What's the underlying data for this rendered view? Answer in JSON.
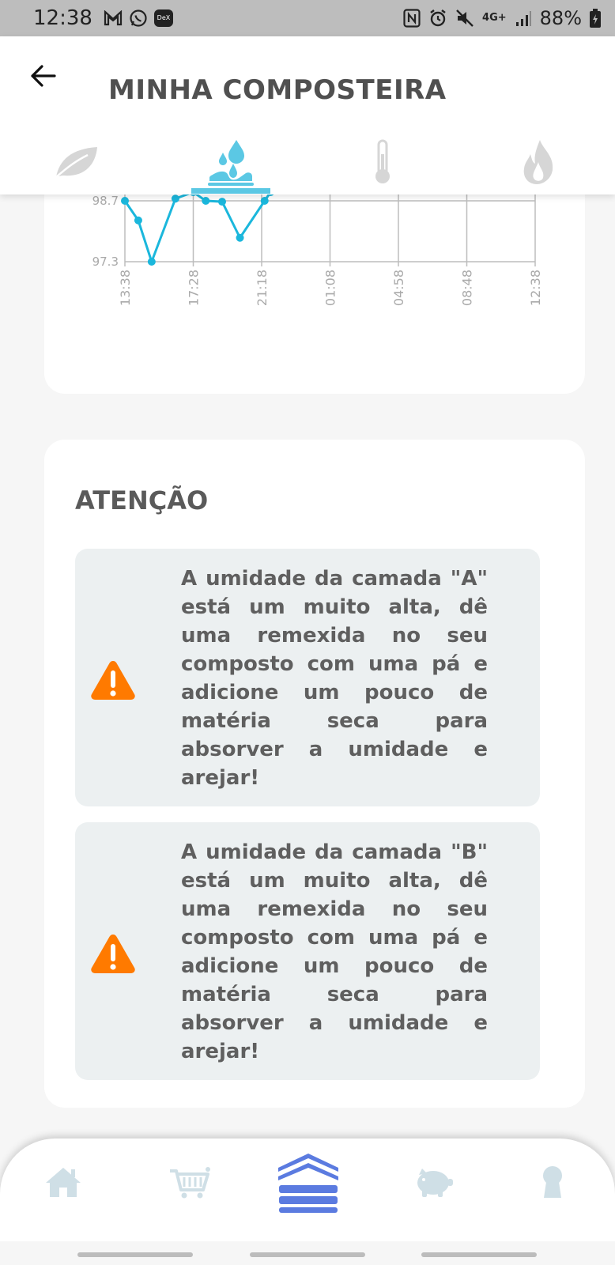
{
  "status_bar": {
    "time": "12:38",
    "left_icons": [
      "gmail-icon",
      "whatsapp-icon",
      "dex-icon"
    ],
    "dex_label": "DeX",
    "network": "4G+",
    "battery": "88%",
    "right_icons": [
      "nfc-icon",
      "alarm-icon",
      "mute-icon",
      "signal-icon",
      "battery-icon"
    ]
  },
  "app_bar": {
    "back_icon": "arrow-left-icon",
    "title": "MINHA COMPOSTEIRA"
  },
  "tabs": [
    {
      "name": "tab-leaf",
      "icon": "leaf-icon",
      "active": false
    },
    {
      "name": "tab-humidity",
      "icon": "water-drops-icon",
      "active": true
    },
    {
      "name": "tab-temperature",
      "icon": "thermometer-icon",
      "active": false
    },
    {
      "name": "tab-gas",
      "icon": "flame-icon",
      "active": false
    }
  ],
  "chart_data": {
    "type": "line",
    "title": "",
    "xlabel": "",
    "ylabel": "",
    "y_tick_labels": [
      "98.7",
      "97.3"
    ],
    "x_tick_labels": [
      "13:38",
      "17:28",
      "21:18",
      "01:08",
      "04:58",
      "08:48",
      "12:38"
    ],
    "ylim": [
      97.3,
      98.7
    ],
    "series": [
      {
        "values": [
          {
            "x": "13:38",
            "y": 98.7
          },
          {
            "x": "14:23",
            "y": 98.25
          },
          {
            "x": "15:08",
            "y": 97.3
          },
          {
            "x": "16:28",
            "y": 98.75
          },
          {
            "x": "17:28",
            "y": 98.9
          },
          {
            "x": "18:10",
            "y": 98.7
          },
          {
            "x": "19:05",
            "y": 98.68
          },
          {
            "x": "20:05",
            "y": 97.85
          },
          {
            "x": "21:28",
            "y": 98.7
          },
          {
            "x": "21:48",
            "y": 98.9
          }
        ]
      }
    ],
    "line_color": "#1bb7dc",
    "grid": true
  },
  "alerts": {
    "title": "ATENÇÃO",
    "icon": "warning-icon",
    "icon_color": "#ff7a00",
    "items": [
      {
        "message": "A umidade da camada \"A\" está um muito alta, dê uma remexida no seu composto com uma pá e adicione um pouco de matéria seca para absorver a umidade e arejar!"
      },
      {
        "message": "A umidade da camada \"B\" está um muito alta, dê uma remexida no seu composto com uma pá e adicione um pouco de matéria seca para absorver a umidade e arejar!"
      }
    ]
  },
  "bottom_nav": [
    {
      "name": "nav-home",
      "icon": "home-icon",
      "active": false
    },
    {
      "name": "nav-shop",
      "icon": "shopping-cart-icon",
      "active": false
    },
    {
      "name": "nav-composter",
      "icon": "layers-icon",
      "active": true
    },
    {
      "name": "nav-savings",
      "icon": "piggy-bank-icon",
      "active": false
    },
    {
      "name": "nav-profile",
      "icon": "keyhole-icon",
      "active": false
    }
  ],
  "colors": {
    "accent": "#5bc8e4",
    "nav_active": "#5b7be0",
    "nav_inactive": "#cfdfe6",
    "tab_inactive": "#d6d6d6"
  }
}
